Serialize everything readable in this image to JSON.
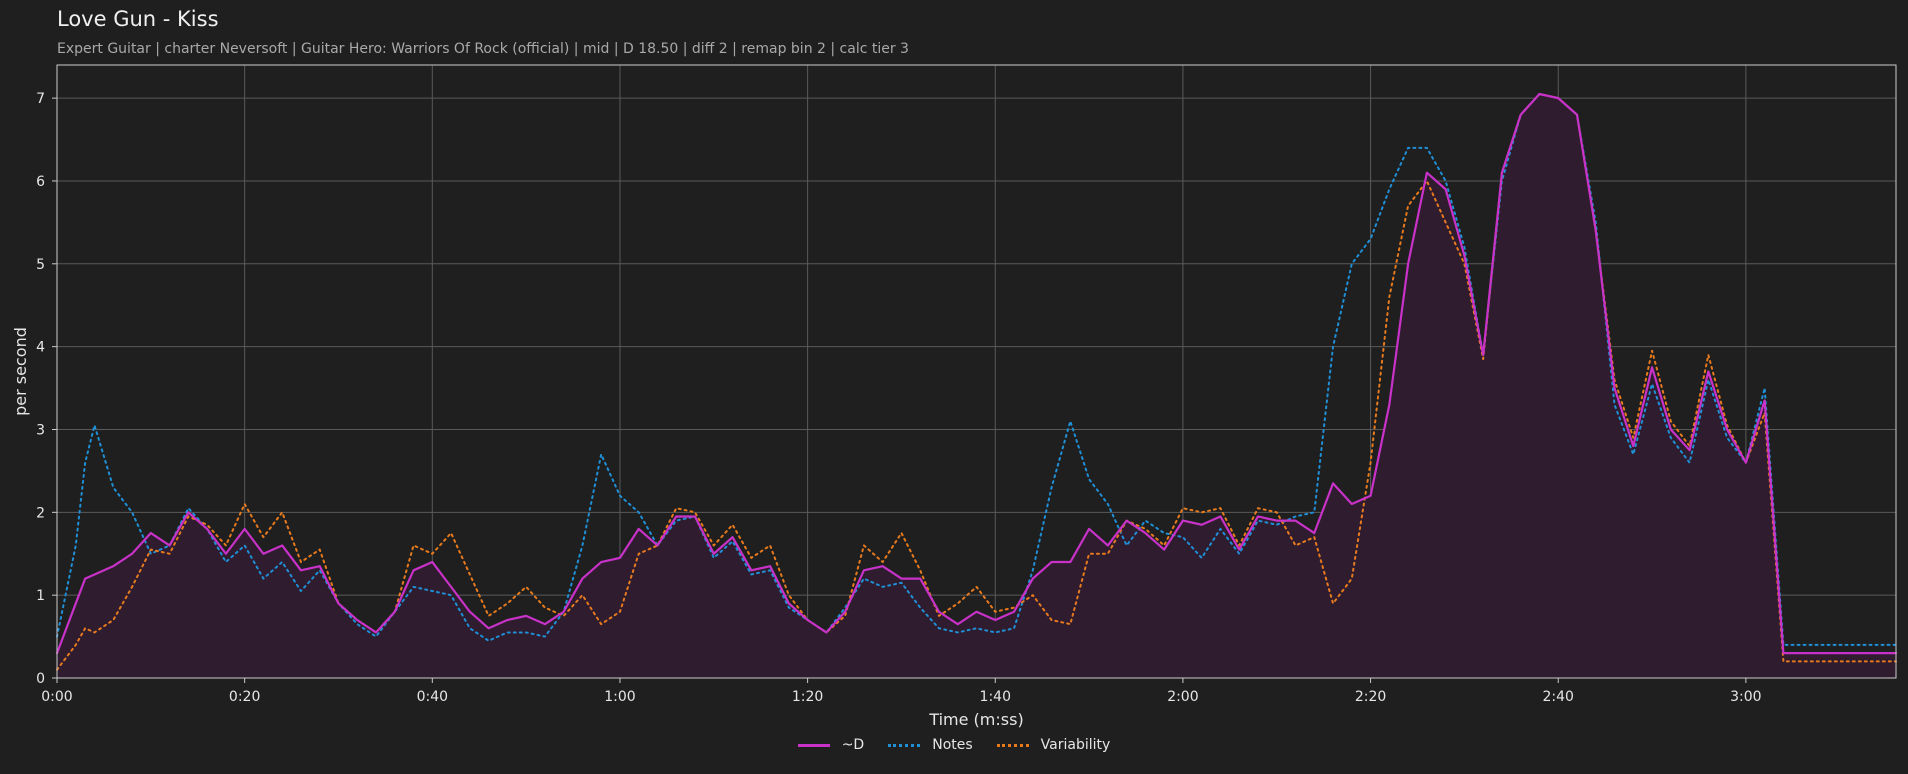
{
  "header": {
    "title": "Love Gun - Kiss",
    "subtitle": "Expert Guitar  |  charter Neversoft  |  Guitar Hero: Warriors Of Rock (official)  |  mid  |  D 18.50  |  diff 2  |  remap bin 2  |  calc tier 3"
  },
  "colors": {
    "background": "#1f1f1f",
    "d_series": "#c832c8",
    "notes_series": "#1f8fd6",
    "variability_series": "#e87a1e",
    "fill": "#2f1c2f",
    "grid": "#5a5a5a"
  },
  "legend": [
    {
      "label": "~D",
      "color": "#c832c8",
      "style": "solid"
    },
    {
      "label": "Notes",
      "color": "#1f8fd6",
      "style": "dotted"
    },
    {
      "label": "Variability",
      "color": "#e87a1e",
      "style": "dotted"
    }
  ],
  "chart_data": {
    "type": "line",
    "xlabel": "Time (m:ss)",
    "ylabel": "per second",
    "xlim": [
      0,
      196
    ],
    "ylim": [
      0,
      7.4
    ],
    "grid": true,
    "legend_position": "bottom-center",
    "x_ticks": [
      {
        "value": 0,
        "label": "0:00"
      },
      {
        "value": 20,
        "label": "0:20"
      },
      {
        "value": 40,
        "label": "0:40"
      },
      {
        "value": 60,
        "label": "1:00"
      },
      {
        "value": 80,
        "label": "1:20"
      },
      {
        "value": 100,
        "label": "1:40"
      },
      {
        "value": 120,
        "label": "2:00"
      },
      {
        "value": 140,
        "label": "2:20"
      },
      {
        "value": 160,
        "label": "2:40"
      },
      {
        "value": 180,
        "label": "3:00"
      }
    ],
    "y_ticks": [
      {
        "value": 0,
        "label": "0"
      },
      {
        "value": 1,
        "label": "1"
      },
      {
        "value": 2,
        "label": "2"
      },
      {
        "value": 3,
        "label": "3"
      },
      {
        "value": 4,
        "label": "4"
      },
      {
        "value": 5,
        "label": "5"
      },
      {
        "value": 6,
        "label": "6"
      },
      {
        "value": 7,
        "label": "7"
      }
    ],
    "x": [
      0,
      2,
      3,
      4,
      6,
      8,
      10,
      12,
      14,
      16,
      18,
      20,
      22,
      24,
      26,
      28,
      30,
      32,
      34,
      36,
      38,
      40,
      42,
      44,
      46,
      48,
      50,
      52,
      54,
      56,
      58,
      60,
      62,
      64,
      66,
      68,
      70,
      72,
      74,
      76,
      78,
      80,
      82,
      84,
      86,
      88,
      90,
      92,
      94,
      96,
      98,
      100,
      102,
      104,
      106,
      108,
      110,
      112,
      114,
      116,
      118,
      120,
      122,
      124,
      126,
      128,
      130,
      132,
      134,
      136,
      138,
      140,
      142,
      144,
      146,
      148,
      150,
      152,
      154,
      156,
      158,
      160,
      162,
      164,
      166,
      168,
      170,
      172,
      174,
      176,
      178,
      180,
      182,
      184,
      186,
      188,
      190,
      192,
      194,
      196
    ],
    "series": [
      {
        "name": "~D",
        "values": [
          0.3,
          0.9,
          1.2,
          1.25,
          1.35,
          1.5,
          1.75,
          1.6,
          2.0,
          1.8,
          1.5,
          1.8,
          1.5,
          1.6,
          1.3,
          1.35,
          0.9,
          0.7,
          0.55,
          0.8,
          1.3,
          1.4,
          1.1,
          0.8,
          0.6,
          0.7,
          0.75,
          0.65,
          0.8,
          1.2,
          1.4,
          1.45,
          1.8,
          1.6,
          1.95,
          1.95,
          1.5,
          1.7,
          1.3,
          1.35,
          0.9,
          0.7,
          0.55,
          0.8,
          1.3,
          1.35,
          1.2,
          1.2,
          0.8,
          0.65,
          0.8,
          0.7,
          0.8,
          1.2,
          1.4,
          1.4,
          1.8,
          1.6,
          1.9,
          1.75,
          1.55,
          1.9,
          1.85,
          1.95,
          1.55,
          1.95,
          1.9,
          1.9,
          1.75,
          2.35,
          2.1,
          2.2,
          3.3,
          5.0,
          6.1,
          5.9,
          5.1,
          3.9,
          6.1,
          6.8,
          7.05,
          7.0,
          6.8,
          5.4,
          3.5,
          2.8,
          3.75,
          3.0,
          2.75,
          3.7,
          3.0,
          2.6,
          3.35,
          0.3,
          0.3,
          0.3,
          0.3,
          0.3,
          0.3,
          0.3
        ]
      },
      {
        "name": "Notes",
        "values": [
          0.5,
          1.6,
          2.6,
          3.05,
          2.3,
          2.0,
          1.5,
          1.6,
          2.05,
          1.8,
          1.4,
          1.6,
          1.2,
          1.4,
          1.05,
          1.3,
          0.9,
          0.65,
          0.5,
          0.8,
          1.1,
          1.05,
          1.0,
          0.6,
          0.45,
          0.55,
          0.55,
          0.5,
          0.8,
          1.6,
          2.7,
          2.2,
          2.0,
          1.6,
          1.9,
          1.95,
          1.45,
          1.65,
          1.25,
          1.3,
          0.85,
          0.7,
          0.55,
          0.85,
          1.2,
          1.1,
          1.15,
          0.85,
          0.6,
          0.55,
          0.6,
          0.55,
          0.6,
          1.3,
          2.3,
          3.1,
          2.4,
          2.1,
          1.6,
          1.9,
          1.75,
          1.7,
          1.45,
          1.8,
          1.5,
          1.9,
          1.85,
          1.95,
          2.0,
          4.0,
          5.0,
          5.3,
          5.9,
          6.4,
          6.4,
          6.0,
          5.2,
          3.9,
          6.0,
          6.8,
          7.05,
          7.0,
          6.8,
          5.5,
          3.3,
          2.7,
          3.55,
          2.9,
          2.6,
          3.6,
          2.9,
          2.6,
          3.5,
          0.4,
          0.4,
          0.4,
          0.4,
          0.4,
          0.4,
          0.4
        ]
      },
      {
        "name": "Variability",
        "values": [
          0.1,
          0.4,
          0.6,
          0.55,
          0.7,
          1.1,
          1.55,
          1.5,
          1.95,
          1.85,
          1.6,
          2.1,
          1.7,
          2.0,
          1.4,
          1.55,
          0.9,
          0.7,
          0.55,
          0.8,
          1.6,
          1.5,
          1.75,
          1.25,
          0.75,
          0.9,
          1.1,
          0.85,
          0.75,
          1.0,
          0.65,
          0.8,
          1.5,
          1.6,
          2.05,
          2.0,
          1.6,
          1.85,
          1.45,
          1.6,
          1.0,
          0.7,
          0.55,
          0.75,
          1.6,
          1.4,
          1.75,
          1.3,
          0.75,
          0.9,
          1.1,
          0.8,
          0.85,
          1.0,
          0.7,
          0.65,
          1.5,
          1.5,
          1.9,
          1.8,
          1.6,
          2.05,
          2.0,
          2.05,
          1.6,
          2.05,
          2.0,
          1.6,
          1.7,
          0.9,
          1.2,
          2.6,
          4.6,
          5.7,
          6.0,
          5.5,
          5.0,
          3.85,
          6.1,
          6.8,
          7.05,
          7.0,
          6.8,
          5.4,
          3.6,
          2.9,
          3.95,
          3.1,
          2.8,
          3.9,
          3.05,
          2.6,
          3.2,
          0.2,
          0.2,
          0.2,
          0.2,
          0.2,
          0.2,
          0.2
        ]
      }
    ]
  }
}
